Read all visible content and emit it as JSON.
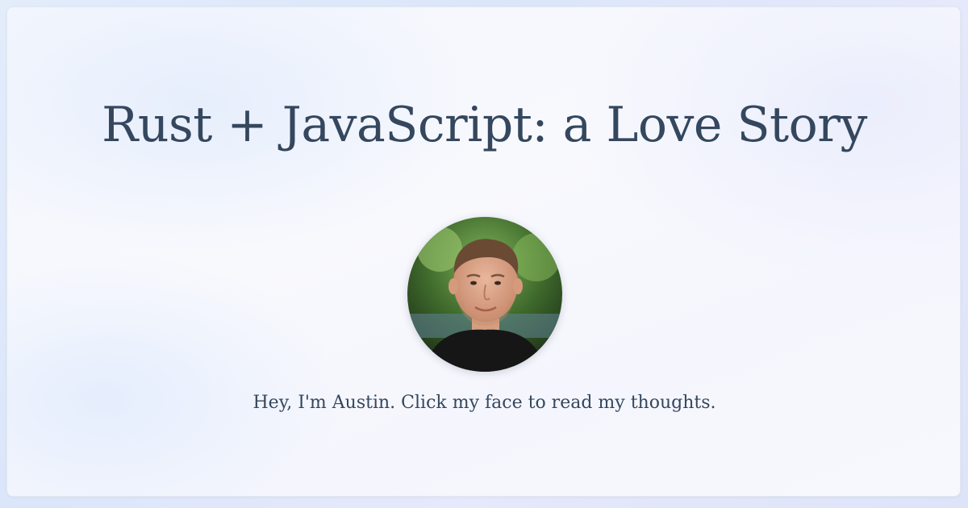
{
  "page": {
    "title": "Rust + JavaScript: a Love Story",
    "tagline": "Hey, I'm Austin. Click my face to read my thoughts."
  },
  "avatar": {
    "icon": "avatar-photo",
    "alt": "Austin"
  },
  "colors": {
    "text": "#34475e",
    "background_tint": "#dbe6fb",
    "card": "#f6f7fd"
  }
}
